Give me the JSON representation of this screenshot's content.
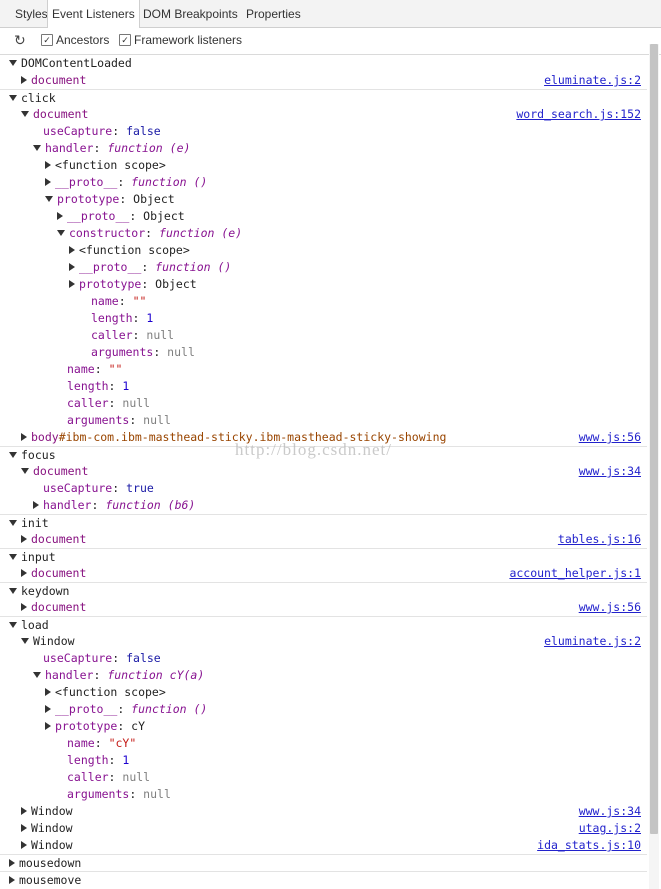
{
  "tabs": [
    "Styles",
    "Event Listeners",
    "DOM Breakpoints",
    "Properties"
  ],
  "toolbar": {
    "refresh_icon": "refresh-icon",
    "ancestors_label": "Ancestors",
    "ancestors_checked": true,
    "framework_label": "Framework listeners",
    "framework_checked": true
  },
  "tree": [
    {
      "indent": 0,
      "tri": "open",
      "parts": [
        {
          "c": "ev",
          "t": "DOMContentLoaded"
        }
      ],
      "sep": false
    },
    {
      "indent": 1,
      "tri": "closed",
      "parts": [
        {
          "c": "node",
          "t": "document"
        }
      ],
      "link": "eluminate.js:2"
    },
    {
      "indent": 0,
      "tri": "open",
      "parts": [
        {
          "c": "ev",
          "t": "click"
        }
      ],
      "sep": true
    },
    {
      "indent": 1,
      "tri": "open",
      "parts": [
        {
          "c": "node",
          "t": "document"
        }
      ],
      "link": "word_search.js:152"
    },
    {
      "indent": 2,
      "tri": "none",
      "parts": [
        {
          "c": "key",
          "t": "useCapture"
        },
        {
          "c": "obj",
          "t": ": "
        },
        {
          "c": "bool",
          "t": "false"
        }
      ]
    },
    {
      "indent": 2,
      "tri": "open",
      "parts": [
        {
          "c": "key",
          "t": "handler"
        },
        {
          "c": "obj",
          "t": ": "
        },
        {
          "c": "fn",
          "t": "function"
        },
        {
          "c": "obj",
          "t": " "
        },
        {
          "c": "fn",
          "t": "(e)"
        }
      ]
    },
    {
      "indent": 3,
      "tri": "closed",
      "parts": [
        {
          "c": "obj",
          "t": "<function scope>"
        }
      ]
    },
    {
      "indent": 3,
      "tri": "closed",
      "parts": [
        {
          "c": "key",
          "t": "__proto__"
        },
        {
          "c": "obj",
          "t": ": "
        },
        {
          "c": "fn",
          "t": "function"
        },
        {
          "c": "obj",
          "t": " "
        },
        {
          "c": "fn",
          "t": "()"
        }
      ]
    },
    {
      "indent": 3,
      "tri": "open",
      "parts": [
        {
          "c": "key",
          "t": "prototype"
        },
        {
          "c": "obj",
          "t": ": Object"
        }
      ]
    },
    {
      "indent": 4,
      "tri": "closed",
      "parts": [
        {
          "c": "key",
          "t": "__proto__"
        },
        {
          "c": "obj",
          "t": ": Object"
        }
      ]
    },
    {
      "indent": 4,
      "tri": "open",
      "parts": [
        {
          "c": "key",
          "t": "constructor"
        },
        {
          "c": "obj",
          "t": ": "
        },
        {
          "c": "fn",
          "t": "function"
        },
        {
          "c": "obj",
          "t": " "
        },
        {
          "c": "fn",
          "t": "(e)"
        }
      ]
    },
    {
      "indent": 5,
      "tri": "closed",
      "parts": [
        {
          "c": "obj",
          "t": "<function scope>"
        }
      ]
    },
    {
      "indent": 5,
      "tri": "closed",
      "parts": [
        {
          "c": "key",
          "t": "__proto__"
        },
        {
          "c": "obj",
          "t": ": "
        },
        {
          "c": "fn",
          "t": "function"
        },
        {
          "c": "obj",
          "t": " "
        },
        {
          "c": "fn",
          "t": "()"
        }
      ]
    },
    {
      "indent": 5,
      "tri": "closed",
      "parts": [
        {
          "c": "key",
          "t": "prototype"
        },
        {
          "c": "obj",
          "t": ": Object"
        }
      ]
    },
    {
      "indent": 6,
      "tri": "none",
      "parts": [
        {
          "c": "key",
          "t": "name"
        },
        {
          "c": "obj",
          "t": ": "
        },
        {
          "c": "str",
          "t": "\"\""
        }
      ]
    },
    {
      "indent": 6,
      "tri": "none",
      "parts": [
        {
          "c": "key",
          "t": "length"
        },
        {
          "c": "obj",
          "t": ": "
        },
        {
          "c": "num",
          "t": "1"
        }
      ]
    },
    {
      "indent": 6,
      "tri": "none",
      "parts": [
        {
          "c": "key",
          "t": "caller"
        },
        {
          "c": "obj",
          "t": ": "
        },
        {
          "c": "null",
          "t": "null"
        }
      ]
    },
    {
      "indent": 6,
      "tri": "none",
      "parts": [
        {
          "c": "key",
          "t": "arguments"
        },
        {
          "c": "obj",
          "t": ": "
        },
        {
          "c": "null",
          "t": "null"
        }
      ]
    },
    {
      "indent": 4,
      "tri": "none",
      "parts": [
        {
          "c": "key",
          "t": "name"
        },
        {
          "c": "obj",
          "t": ": "
        },
        {
          "c": "str",
          "t": "\"\""
        }
      ]
    },
    {
      "indent": 4,
      "tri": "none",
      "parts": [
        {
          "c": "key",
          "t": "length"
        },
        {
          "c": "obj",
          "t": ": "
        },
        {
          "c": "num",
          "t": "1"
        }
      ]
    },
    {
      "indent": 4,
      "tri": "none",
      "parts": [
        {
          "c": "key",
          "t": "caller"
        },
        {
          "c": "obj",
          "t": ": "
        },
        {
          "c": "null",
          "t": "null"
        }
      ]
    },
    {
      "indent": 4,
      "tri": "none",
      "parts": [
        {
          "c": "key",
          "t": "arguments"
        },
        {
          "c": "obj",
          "t": ": "
        },
        {
          "c": "null",
          "t": "null"
        }
      ]
    },
    {
      "indent": 1,
      "tri": "closed",
      "parts": [
        {
          "c": "node",
          "t": "body"
        },
        {
          "c": "sel-id",
          "t": "#ibm-com.ibm-masthead-sticky.ibm-masthead-sticky-showing"
        }
      ],
      "link": "www.js:56"
    },
    {
      "indent": 0,
      "tri": "open",
      "parts": [
        {
          "c": "ev",
          "t": "focus"
        }
      ],
      "sep": true
    },
    {
      "indent": 1,
      "tri": "open",
      "parts": [
        {
          "c": "node",
          "t": "document"
        }
      ],
      "link": "www.js:34"
    },
    {
      "indent": 2,
      "tri": "none",
      "parts": [
        {
          "c": "key",
          "t": "useCapture"
        },
        {
          "c": "obj",
          "t": ": "
        },
        {
          "c": "bool",
          "t": "true"
        }
      ]
    },
    {
      "indent": 2,
      "tri": "closed",
      "parts": [
        {
          "c": "key",
          "t": "handler"
        },
        {
          "c": "obj",
          "t": ": "
        },
        {
          "c": "fn",
          "t": "function"
        },
        {
          "c": "obj",
          "t": " "
        },
        {
          "c": "fn",
          "t": "(b6)"
        }
      ]
    },
    {
      "indent": 0,
      "tri": "open",
      "parts": [
        {
          "c": "ev",
          "t": "init"
        }
      ],
      "sep": true
    },
    {
      "indent": 1,
      "tri": "closed",
      "parts": [
        {
          "c": "node",
          "t": "document"
        }
      ],
      "link": "tables.js:16"
    },
    {
      "indent": 0,
      "tri": "open",
      "parts": [
        {
          "c": "ev",
          "t": "input"
        }
      ],
      "sep": true
    },
    {
      "indent": 1,
      "tri": "closed",
      "parts": [
        {
          "c": "node",
          "t": "document"
        }
      ],
      "link": "account_helper.js:1"
    },
    {
      "indent": 0,
      "tri": "open",
      "parts": [
        {
          "c": "ev",
          "t": "keydown"
        }
      ],
      "sep": true
    },
    {
      "indent": 1,
      "tri": "closed",
      "parts": [
        {
          "c": "node",
          "t": "document"
        }
      ],
      "link": "www.js:56"
    },
    {
      "indent": 0,
      "tri": "open",
      "parts": [
        {
          "c": "ev",
          "t": "load"
        }
      ],
      "sep": true
    },
    {
      "indent": 1,
      "tri": "open",
      "parts": [
        {
          "c": "obj",
          "t": "Window"
        }
      ],
      "link": "eluminate.js:2"
    },
    {
      "indent": 2,
      "tri": "none",
      "parts": [
        {
          "c": "key",
          "t": "useCapture"
        },
        {
          "c": "obj",
          "t": ": "
        },
        {
          "c": "bool",
          "t": "false"
        }
      ]
    },
    {
      "indent": 2,
      "tri": "open",
      "parts": [
        {
          "c": "key",
          "t": "handler"
        },
        {
          "c": "obj",
          "t": ": "
        },
        {
          "c": "fn",
          "t": "function"
        },
        {
          "c": "obj",
          "t": " "
        },
        {
          "c": "fn",
          "t": "cY(a)"
        }
      ]
    },
    {
      "indent": 3,
      "tri": "closed",
      "parts": [
        {
          "c": "obj",
          "t": "<function scope>"
        }
      ]
    },
    {
      "indent": 3,
      "tri": "closed",
      "parts": [
        {
          "c": "key",
          "t": "__proto__"
        },
        {
          "c": "obj",
          "t": ": "
        },
        {
          "c": "fn",
          "t": "function"
        },
        {
          "c": "obj",
          "t": " "
        },
        {
          "c": "fn",
          "t": "()"
        }
      ]
    },
    {
      "indent": 3,
      "tri": "closed",
      "parts": [
        {
          "c": "key",
          "t": "prototype"
        },
        {
          "c": "obj",
          "t": ": cY"
        }
      ]
    },
    {
      "indent": 4,
      "tri": "none",
      "parts": [
        {
          "c": "key",
          "t": "name"
        },
        {
          "c": "obj",
          "t": ": "
        },
        {
          "c": "str",
          "t": "\"cY\""
        }
      ]
    },
    {
      "indent": 4,
      "tri": "none",
      "parts": [
        {
          "c": "key",
          "t": "length"
        },
        {
          "c": "obj",
          "t": ": "
        },
        {
          "c": "num",
          "t": "1"
        }
      ]
    },
    {
      "indent": 4,
      "tri": "none",
      "parts": [
        {
          "c": "key",
          "t": "caller"
        },
        {
          "c": "obj",
          "t": ": "
        },
        {
          "c": "null",
          "t": "null"
        }
      ]
    },
    {
      "indent": 4,
      "tri": "none",
      "parts": [
        {
          "c": "key",
          "t": "arguments"
        },
        {
          "c": "obj",
          "t": ": "
        },
        {
          "c": "null",
          "t": "null"
        }
      ]
    },
    {
      "indent": 1,
      "tri": "closed",
      "parts": [
        {
          "c": "obj",
          "t": "Window"
        }
      ],
      "link": "www.js:34"
    },
    {
      "indent": 1,
      "tri": "closed",
      "parts": [
        {
          "c": "obj",
          "t": "Window"
        }
      ],
      "link": "utag.js:2"
    },
    {
      "indent": 1,
      "tri": "closed",
      "parts": [
        {
          "c": "obj",
          "t": "Window"
        }
      ],
      "link": "ida_stats.js:10"
    },
    {
      "indent": 0,
      "tri": "closed",
      "parts": [
        {
          "c": "ev",
          "t": "mousedown"
        }
      ],
      "sep": true
    },
    {
      "indent": 0,
      "tri": "closed",
      "parts": [
        {
          "c": "ev",
          "t": "mousemove"
        }
      ],
      "sep": true
    }
  ],
  "watermark": "http://blog.csdn.net/"
}
